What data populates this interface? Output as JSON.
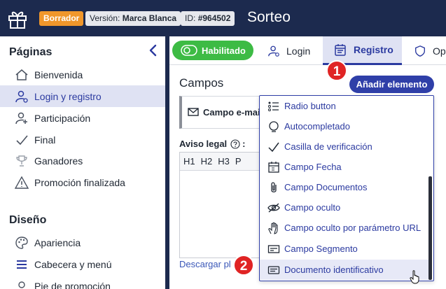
{
  "header": {
    "status_badge": "Borrador",
    "version_label": "Versión:",
    "version_value": "Marca Blanca",
    "id_label": "ID:",
    "id_value": "#964502",
    "title": "Sorteo"
  },
  "sidebar": {
    "pages_title": "Páginas",
    "pages": [
      {
        "label": "Bienvenida",
        "icon": "home-icon"
      },
      {
        "label": "Login y registro",
        "icon": "user-login-icon",
        "active": true
      },
      {
        "label": "Participación",
        "icon": "user-add-icon"
      },
      {
        "label": "Final",
        "icon": "check-icon"
      },
      {
        "label": "Ganadores",
        "icon": "trophy-icon"
      },
      {
        "label": "Promoción finalizada",
        "icon": "warning-icon"
      }
    ],
    "design_title": "Diseño",
    "design": [
      {
        "label": "Apariencia",
        "icon": "palette-icon"
      },
      {
        "label": "Cabecera y menú",
        "icon": "menu-icon"
      },
      {
        "label": "Pie de promoción",
        "icon": "footer-icon"
      }
    ]
  },
  "tabs": {
    "enabled": "Habilitado",
    "login": "Login",
    "registro": "Registro",
    "options": "Op"
  },
  "main": {
    "fields_title": "Campos",
    "add_button": "Añadir elemento",
    "field_card": "Campo e-mai",
    "legal_label": "Aviso legal",
    "legal_colon": ":",
    "toolbar": [
      "H1",
      "H2",
      "H3",
      "P"
    ],
    "download_link": "Descargar pl"
  },
  "dropdown": {
    "items": [
      {
        "label": "Radio button",
        "icon": "list-icon"
      },
      {
        "label": "Autocompletado",
        "icon": "speech-bubble-icon"
      },
      {
        "label": "Casilla de verificación",
        "icon": "checkmark-icon"
      },
      {
        "label": "Campo Fecha",
        "icon": "calendar-icon"
      },
      {
        "label": "Campo Documentos",
        "icon": "paperclip-icon"
      },
      {
        "label": "Campo oculto",
        "icon": "eye-off-icon"
      },
      {
        "label": "Campo oculto por parámetro URL",
        "icon": "hand-icon"
      },
      {
        "label": "Campo Segmento",
        "icon": "segment-icon"
      },
      {
        "label": "Documento identificativo",
        "icon": "id-card-icon",
        "hover": true
      }
    ]
  },
  "callouts": {
    "first": "1",
    "second": "2"
  },
  "colors": {
    "header_bg": "#1c2a4e",
    "accent": "#2f3fa8",
    "enabled_green": "#3dbb44",
    "draft_orange": "#f0972b",
    "callout_red": "#e02424"
  }
}
